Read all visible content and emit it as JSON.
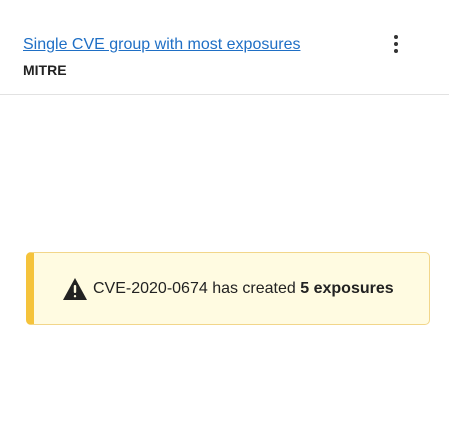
{
  "card": {
    "title": "Single CVE group with most exposures",
    "subtitle": "MITRE",
    "menu_icon": "more-vertical-icon"
  },
  "alert": {
    "icon": "warning-icon",
    "text_prefix": "CVE-2020-0674 has created",
    "count_text": "5 exposures",
    "accent_color": "#f5c33b",
    "background_color": "#fffbe1"
  },
  "colors": {
    "link": "#1f6fc5"
  }
}
